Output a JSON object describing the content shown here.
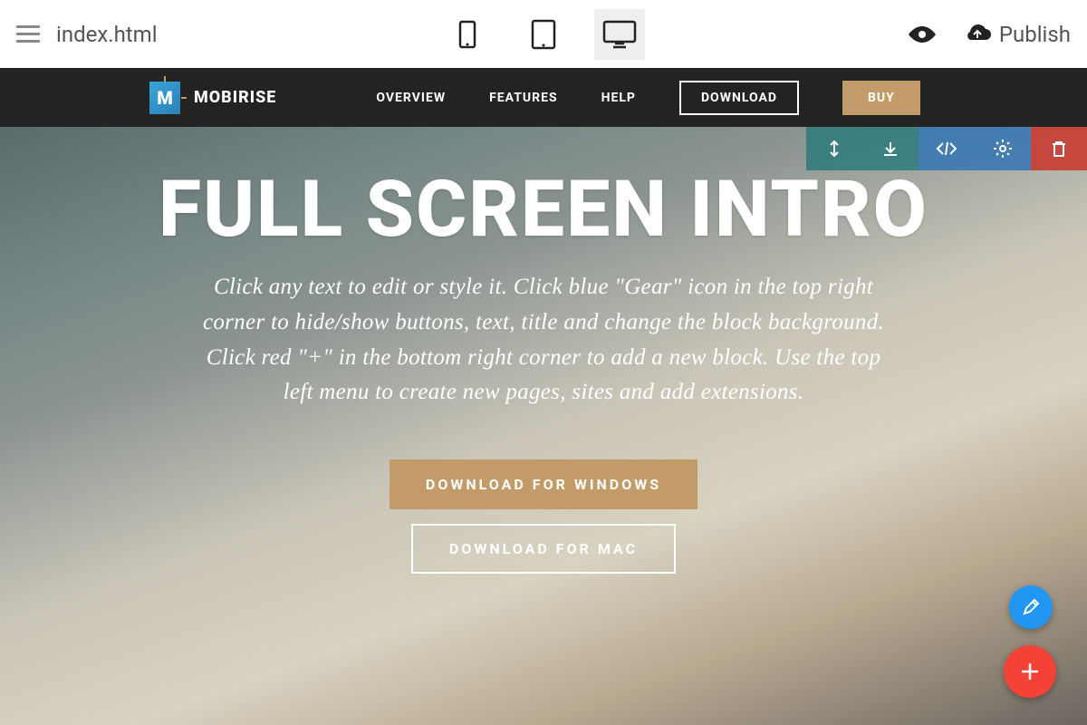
{
  "app": {
    "filename": "index.html",
    "publish_label": "Publish"
  },
  "nav": {
    "brand": "MOBIRISE",
    "items": [
      "OVERVIEW",
      "FEATURES",
      "HELP"
    ],
    "download": "DOWNLOAD",
    "buy": "BUY"
  },
  "hero": {
    "title": "FULL SCREEN INTRO",
    "description": "Click any text to edit or style it. Click blue \"Gear\" icon in the top right corner to hide/show buttons, text, title and change the block background. Click red \"+\" in the bottom right corner to add a new block. Use the top left menu to create new pages, sites and add extensions.",
    "btn_windows": "DOWNLOAD FOR WINDOWS",
    "btn_mac": "DOWNLOAD FOR MAC"
  }
}
